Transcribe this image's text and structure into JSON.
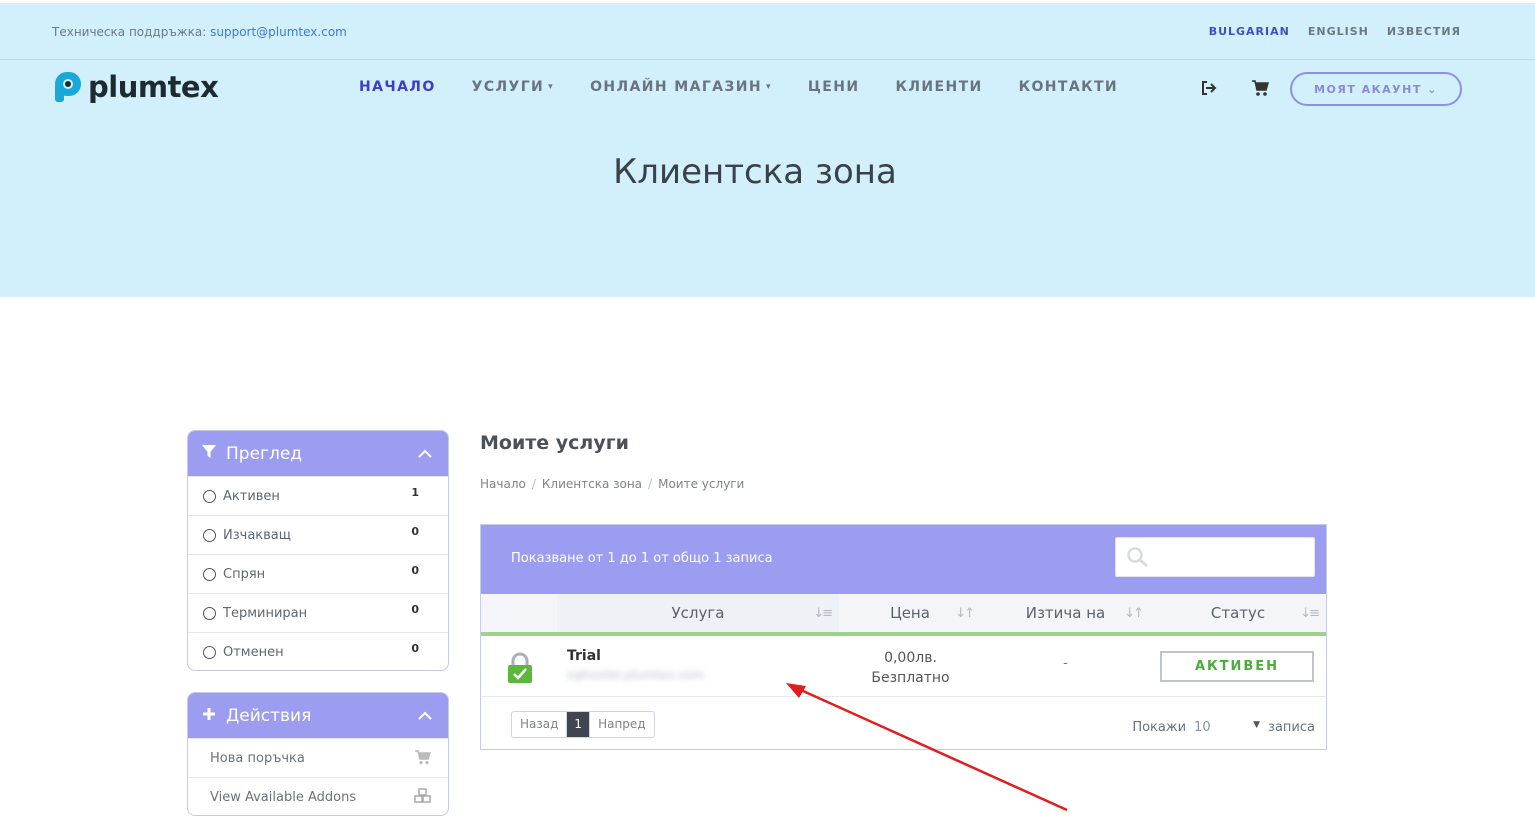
{
  "topbar": {
    "support_label": "Техническа поддръжка:",
    "support_email": "support@plumtex.com",
    "languages": [
      "BULGARIAN",
      "ENGLISH",
      "ИЗВЕСТИЯ"
    ]
  },
  "brand": {
    "name": "plumtex",
    "accent": "#3d3dc8",
    "logo_color": "#17a9d9"
  },
  "nav": {
    "items": [
      {
        "label": "НАЧАЛО",
        "dropdown": false,
        "active": true
      },
      {
        "label": "УСЛУГИ",
        "dropdown": true
      },
      {
        "label": "ОНЛАЙН МАГАЗИН",
        "dropdown": true
      },
      {
        "label": "ЦЕНИ",
        "dropdown": false
      },
      {
        "label": "КЛИЕНТИ",
        "dropdown": false
      },
      {
        "label": "КОНТАКТИ",
        "dropdown": false
      }
    ],
    "caret": "▾",
    "icons": [
      "logout-icon",
      "cart-icon"
    ],
    "account_label": "МОЯТ АКАУНТ ⌄"
  },
  "hero": {
    "title": "Клиентска зона",
    "background": "#d2f0fb"
  },
  "sidebar": {
    "overview": {
      "title": "Преглед",
      "items": [
        {
          "label": "Активен",
          "count": "1"
        },
        {
          "label": "Изчакващ",
          "count": "0"
        },
        {
          "label": "Спрян",
          "count": "0"
        },
        {
          "label": "Терминиран",
          "count": "0"
        },
        {
          "label": "Отменен",
          "count": "0"
        }
      ]
    },
    "actions": {
      "title": "Действия",
      "items": [
        {
          "label": "Нова поръчка",
          "icon": "cart-icon"
        },
        {
          "label": "View Available Addons",
          "icon": "cubes-icon"
        }
      ]
    },
    "panel_color": "#9c9cf0"
  },
  "main": {
    "title": "Моите услуги",
    "breadcrumb": [
      "Начало",
      "Клиентска зона",
      "Моите услуги"
    ],
    "table": {
      "info": "Показване от 1 до 1 от общо 1 записа",
      "search_placeholder": "",
      "columns": [
        "Услуга",
        "Цена",
        "Изтича на",
        "Статус"
      ],
      "rows": [
        {
          "icon": "green-lock-icon",
          "service": "Trial",
          "domain": "sqlhoster.plumtex.com",
          "price": "0,00лв.",
          "billing": "Безплатно",
          "expires": "-",
          "status": "АКТИВЕН"
        }
      ],
      "pager": {
        "prev": "Назад",
        "current": "1",
        "next": "Напред"
      },
      "show": {
        "label": "Покажи",
        "value": "10",
        "suffix": "записа"
      }
    },
    "status_color": "#4aac3a"
  }
}
